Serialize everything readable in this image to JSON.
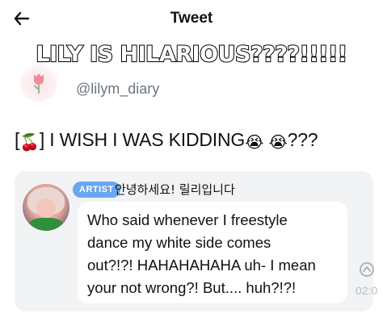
{
  "header": {
    "back_icon": "arrow-left-icon",
    "title": "Tweet"
  },
  "overlay": {
    "caption": "LILY IS HILARIOUS????!!!!!"
  },
  "author": {
    "avatar_icon": "tulip-icon",
    "handle": "@lilym_diary"
  },
  "tweet": {
    "prefix": "[",
    "cherry_icon": "🍒",
    "text": "] I WISH I WAS KIDDING",
    "emoji_1": "😭",
    "emoji_2": "😭",
    "suffix": "???"
  },
  "card": {
    "badge": "ARTIST",
    "greeting": "안녕하세요! 릴리입니다",
    "message_lines": [
      "Who said whenever I freestyle",
      "dance my white side comes",
      "out?!?! HAHAHAHAHA uh- I mean",
      "your not wrong?! But.... huh?!?!"
    ],
    "side_icon": "reply-arrow-icon",
    "timestamp": "02:0"
  },
  "colors": {
    "badge_bg": "#6aa6f0",
    "card_bg": "#f2f3f5",
    "handle_gray": "#6b7580"
  }
}
